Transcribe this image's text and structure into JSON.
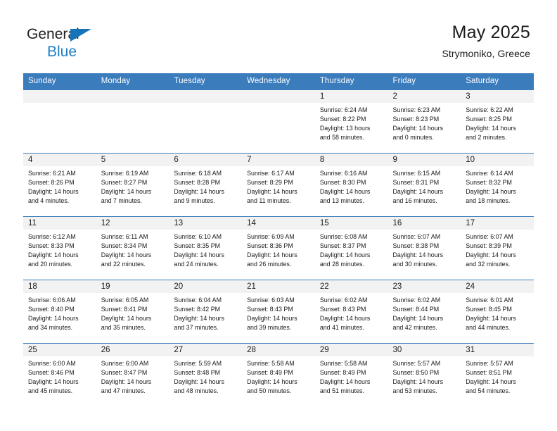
{
  "brand": {
    "name_part1": "General",
    "name_part2": "Blue",
    "color_dark": "#231f20",
    "color_blue": "#1f7fc4"
  },
  "header": {
    "month_title": "May 2025",
    "location": "Strymoniko, Greece"
  },
  "theme": {
    "header_blue": "#3b7cbd",
    "daynum_band": "#f2f2f2",
    "text": "#1a1a1a"
  },
  "weekdays": [
    "Sunday",
    "Monday",
    "Tuesday",
    "Wednesday",
    "Thursday",
    "Friday",
    "Saturday"
  ],
  "weeks": [
    [
      {
        "day": "",
        "lines": []
      },
      {
        "day": "",
        "lines": []
      },
      {
        "day": "",
        "lines": []
      },
      {
        "day": "",
        "lines": []
      },
      {
        "day": "1",
        "lines": [
          "Sunrise: 6:24 AM",
          "Sunset: 8:22 PM",
          "Daylight: 13 hours",
          "and 58 minutes."
        ]
      },
      {
        "day": "2",
        "lines": [
          "Sunrise: 6:23 AM",
          "Sunset: 8:23 PM",
          "Daylight: 14 hours",
          "and 0 minutes."
        ]
      },
      {
        "day": "3",
        "lines": [
          "Sunrise: 6:22 AM",
          "Sunset: 8:25 PM",
          "Daylight: 14 hours",
          "and 2 minutes."
        ]
      }
    ],
    [
      {
        "day": "4",
        "lines": [
          "Sunrise: 6:21 AM",
          "Sunset: 8:26 PM",
          "Daylight: 14 hours",
          "and 4 minutes."
        ]
      },
      {
        "day": "5",
        "lines": [
          "Sunrise: 6:19 AM",
          "Sunset: 8:27 PM",
          "Daylight: 14 hours",
          "and 7 minutes."
        ]
      },
      {
        "day": "6",
        "lines": [
          "Sunrise: 6:18 AM",
          "Sunset: 8:28 PM",
          "Daylight: 14 hours",
          "and 9 minutes."
        ]
      },
      {
        "day": "7",
        "lines": [
          "Sunrise: 6:17 AM",
          "Sunset: 8:29 PM",
          "Daylight: 14 hours",
          "and 11 minutes."
        ]
      },
      {
        "day": "8",
        "lines": [
          "Sunrise: 6:16 AM",
          "Sunset: 8:30 PM",
          "Daylight: 14 hours",
          "and 13 minutes."
        ]
      },
      {
        "day": "9",
        "lines": [
          "Sunrise: 6:15 AM",
          "Sunset: 8:31 PM",
          "Daylight: 14 hours",
          "and 16 minutes."
        ]
      },
      {
        "day": "10",
        "lines": [
          "Sunrise: 6:14 AM",
          "Sunset: 8:32 PM",
          "Daylight: 14 hours",
          "and 18 minutes."
        ]
      }
    ],
    [
      {
        "day": "11",
        "lines": [
          "Sunrise: 6:12 AM",
          "Sunset: 8:33 PM",
          "Daylight: 14 hours",
          "and 20 minutes."
        ]
      },
      {
        "day": "12",
        "lines": [
          "Sunrise: 6:11 AM",
          "Sunset: 8:34 PM",
          "Daylight: 14 hours",
          "and 22 minutes."
        ]
      },
      {
        "day": "13",
        "lines": [
          "Sunrise: 6:10 AM",
          "Sunset: 8:35 PM",
          "Daylight: 14 hours",
          "and 24 minutes."
        ]
      },
      {
        "day": "14",
        "lines": [
          "Sunrise: 6:09 AM",
          "Sunset: 8:36 PM",
          "Daylight: 14 hours",
          "and 26 minutes."
        ]
      },
      {
        "day": "15",
        "lines": [
          "Sunrise: 6:08 AM",
          "Sunset: 8:37 PM",
          "Daylight: 14 hours",
          "and 28 minutes."
        ]
      },
      {
        "day": "16",
        "lines": [
          "Sunrise: 6:07 AM",
          "Sunset: 8:38 PM",
          "Daylight: 14 hours",
          "and 30 minutes."
        ]
      },
      {
        "day": "17",
        "lines": [
          "Sunrise: 6:07 AM",
          "Sunset: 8:39 PM",
          "Daylight: 14 hours",
          "and 32 minutes."
        ]
      }
    ],
    [
      {
        "day": "18",
        "lines": [
          "Sunrise: 6:06 AM",
          "Sunset: 8:40 PM",
          "Daylight: 14 hours",
          "and 34 minutes."
        ]
      },
      {
        "day": "19",
        "lines": [
          "Sunrise: 6:05 AM",
          "Sunset: 8:41 PM",
          "Daylight: 14 hours",
          "and 35 minutes."
        ]
      },
      {
        "day": "20",
        "lines": [
          "Sunrise: 6:04 AM",
          "Sunset: 8:42 PM",
          "Daylight: 14 hours",
          "and 37 minutes."
        ]
      },
      {
        "day": "21",
        "lines": [
          "Sunrise: 6:03 AM",
          "Sunset: 8:43 PM",
          "Daylight: 14 hours",
          "and 39 minutes."
        ]
      },
      {
        "day": "22",
        "lines": [
          "Sunrise: 6:02 AM",
          "Sunset: 8:43 PM",
          "Daylight: 14 hours",
          "and 41 minutes."
        ]
      },
      {
        "day": "23",
        "lines": [
          "Sunrise: 6:02 AM",
          "Sunset: 8:44 PM",
          "Daylight: 14 hours",
          "and 42 minutes."
        ]
      },
      {
        "day": "24",
        "lines": [
          "Sunrise: 6:01 AM",
          "Sunset: 8:45 PM",
          "Daylight: 14 hours",
          "and 44 minutes."
        ]
      }
    ],
    [
      {
        "day": "25",
        "lines": [
          "Sunrise: 6:00 AM",
          "Sunset: 8:46 PM",
          "Daylight: 14 hours",
          "and 45 minutes."
        ]
      },
      {
        "day": "26",
        "lines": [
          "Sunrise: 6:00 AM",
          "Sunset: 8:47 PM",
          "Daylight: 14 hours",
          "and 47 minutes."
        ]
      },
      {
        "day": "27",
        "lines": [
          "Sunrise: 5:59 AM",
          "Sunset: 8:48 PM",
          "Daylight: 14 hours",
          "and 48 minutes."
        ]
      },
      {
        "day": "28",
        "lines": [
          "Sunrise: 5:58 AM",
          "Sunset: 8:49 PM",
          "Daylight: 14 hours",
          "and 50 minutes."
        ]
      },
      {
        "day": "29",
        "lines": [
          "Sunrise: 5:58 AM",
          "Sunset: 8:49 PM",
          "Daylight: 14 hours",
          "and 51 minutes."
        ]
      },
      {
        "day": "30",
        "lines": [
          "Sunrise: 5:57 AM",
          "Sunset: 8:50 PM",
          "Daylight: 14 hours",
          "and 53 minutes."
        ]
      },
      {
        "day": "31",
        "lines": [
          "Sunrise: 5:57 AM",
          "Sunset: 8:51 PM",
          "Daylight: 14 hours",
          "and 54 minutes."
        ]
      }
    ]
  ]
}
